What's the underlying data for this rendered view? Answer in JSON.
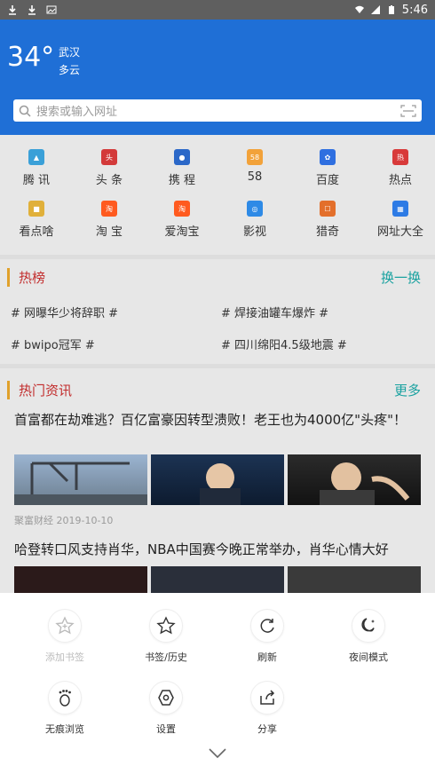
{
  "status": {
    "time": "5:46"
  },
  "weather": {
    "temp": "34°",
    "city": "武汉",
    "desc": "多云"
  },
  "search": {
    "placeholder": "搜索或输入网址"
  },
  "shortcuts": [
    {
      "label": "腾 讯",
      "color": "#3aa0d8"
    },
    {
      "label": "头 条",
      "color": "#d33a3a"
    },
    {
      "label": "携 程",
      "color": "#2b68c8"
    },
    {
      "label": "58",
      "color": "#f2a23a"
    },
    {
      "label": "百度",
      "color": "#2f6fe0"
    },
    {
      "label": "热点",
      "color": "#d83a3a"
    },
    {
      "label": "看点啥",
      "color": "#e0b03a"
    },
    {
      "label": "淘 宝",
      "color": "#ff5a1f"
    },
    {
      "label": "爱淘宝",
      "color": "#ff5a1f"
    },
    {
      "label": "影视",
      "color": "#2e8ae6"
    },
    {
      "label": "猎奇",
      "color": "#e36f2b"
    },
    {
      "label": "网址大全",
      "color": "#2d7be5"
    }
  ],
  "hot": {
    "title": "热榜",
    "action": "换一换",
    "items": [
      "# 网曝华少将辞职 #",
      "# 焊接油罐车爆炸 #",
      "# bwipo冠军 #",
      "# 四川绵阳4.5级地震 #"
    ]
  },
  "news": {
    "title": "热门资讯",
    "action": "更多",
    "articles": [
      {
        "title": "首富都在劫难逃？百亿富豪因转型溃败！老王也为4000亿\"头疼\"！",
        "meta": "聚富财经 2019-10-10"
      },
      {
        "title": "哈登转口风支持肖华，NBA中国赛今晚正常举办，肖华心情大好"
      }
    ]
  },
  "sheet": {
    "actions": [
      {
        "label": "添加书签",
        "icon": "star-plus-icon",
        "disabled": true
      },
      {
        "label": "书签/历史",
        "icon": "star-icon",
        "disabled": false
      },
      {
        "label": "刷新",
        "icon": "refresh-icon",
        "disabled": false
      },
      {
        "label": "夜间模式",
        "icon": "moon-icon",
        "disabled": false
      },
      {
        "label": "无痕浏览",
        "icon": "paw-icon",
        "disabled": false
      },
      {
        "label": "设置",
        "icon": "gear-icon",
        "disabled": false
      },
      {
        "label": "分享",
        "icon": "share-icon",
        "disabled": false
      }
    ]
  }
}
